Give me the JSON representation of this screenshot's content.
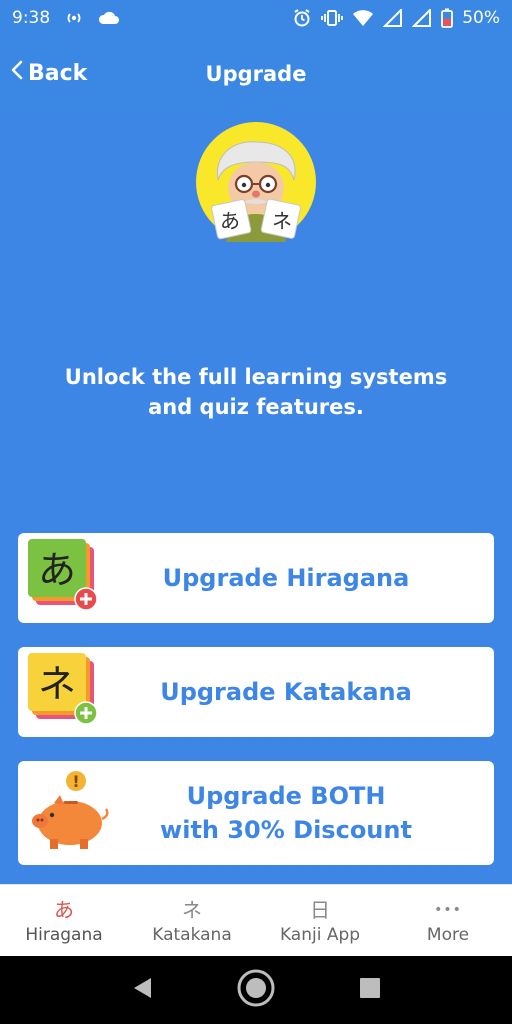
{
  "status": {
    "time": "9:38",
    "battery": "50%"
  },
  "header": {
    "back_label": "Back",
    "title": "Upgrade"
  },
  "avatar": {
    "glyph_left": "あ",
    "glyph_right": "ネ"
  },
  "tagline": "Unlock the full learning systems and quiz features.",
  "cards": [
    {
      "label": "Upgrade Hiragana",
      "icon_glyph": "あ",
      "icon": "hiragana-card-plus-icon"
    },
    {
      "label": "Upgrade Katakana",
      "icon_glyph": "ネ",
      "icon": "katakana-card-plus-icon"
    },
    {
      "label_line1": "Upgrade BOTH",
      "label_line2_prefix": "with ",
      "label_line2_bold": "30% Discount",
      "icon": "piggy-bank-icon"
    }
  ],
  "bottom_nav": [
    {
      "glyph": "あ",
      "label": "Hiragana",
      "active": true
    },
    {
      "glyph": "ネ",
      "label": "Katakana",
      "active": false
    },
    {
      "glyph": "日",
      "label": "Kanji App",
      "active": false
    },
    {
      "glyph": "•••",
      "label": "More",
      "active": false
    }
  ],
  "colors": {
    "primary": "#3d86e6",
    "active_tab": "#e0554e",
    "card_bg": "#ffffff"
  }
}
